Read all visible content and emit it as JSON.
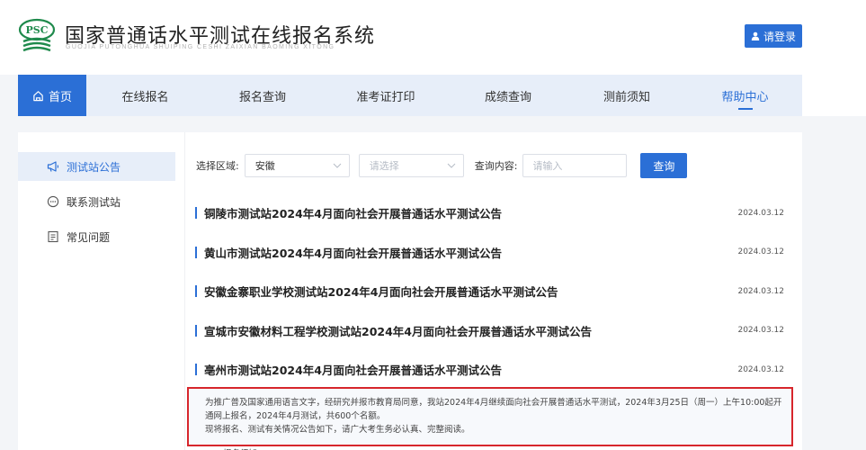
{
  "header": {
    "logo_text": "PSC",
    "title": "国家普通话水平测试在线报名系统",
    "subtitle": "GUOJIA PUTONGHUA SHUIPING CESHI ZAIXIAN BAOMING XITONG",
    "login_label": "请登录"
  },
  "nav": {
    "items": [
      {
        "label": "首页",
        "icon": "home-icon"
      },
      {
        "label": "在线报名"
      },
      {
        "label": "报名查询"
      },
      {
        "label": "准考证打印"
      },
      {
        "label": "成绩查询"
      },
      {
        "label": "测前须知"
      },
      {
        "label": "帮助中心"
      }
    ]
  },
  "sidebar": {
    "items": [
      {
        "label": "测试站公告",
        "icon": "megaphone-icon"
      },
      {
        "label": "联系测试站",
        "icon": "chat-icon"
      },
      {
        "label": "常见问题",
        "icon": "document-icon"
      }
    ]
  },
  "filters": {
    "region_label": "选择区域:",
    "province_value": "安徽",
    "city_placeholder": "请选择",
    "query_label": "查询内容:",
    "query_placeholder": "请输入",
    "query_button": "查询"
  },
  "news": [
    {
      "title": "铜陵市测试站2024年4月面向社会开展普通话水平测试公告",
      "date": "2024.03.12"
    },
    {
      "title": "黄山市测试站2024年4月面向社会开展普通话水平测试公告",
      "date": "2024.03.12"
    },
    {
      "title": "安徽金寨职业学校测试站2024年4月面向社会开展普通话水平测试公告",
      "date": "2024.03.12"
    },
    {
      "title": "宣城市安徽材料工程学校测试站2024年4月面向社会开展普通话水平测试公告",
      "date": "2024.03.12"
    },
    {
      "title": "亳州市测试站2024年4月面向社会开展普通话水平测试公告",
      "date": "2024.03.12"
    }
  ],
  "detail": {
    "line1": "为推广普及国家通用语言文字，经研究并报市教育局同意，我站2024年4月继续面向社会开展普通话水平测试，2024年3月25日（周一）上午10:00起开通网上报名，2024年4月测试，共600个名额。",
    "line2": "现将报名、测试有关情况公告如下，请广大考生务必认真、完整阅读。",
    "line3": "一、报名须知"
  },
  "colors": {
    "primary": "#2b6fd6",
    "nav_bg": "#e7eef9",
    "logo_green": "#1f8a4c",
    "highlight_border": "#d7262c"
  }
}
